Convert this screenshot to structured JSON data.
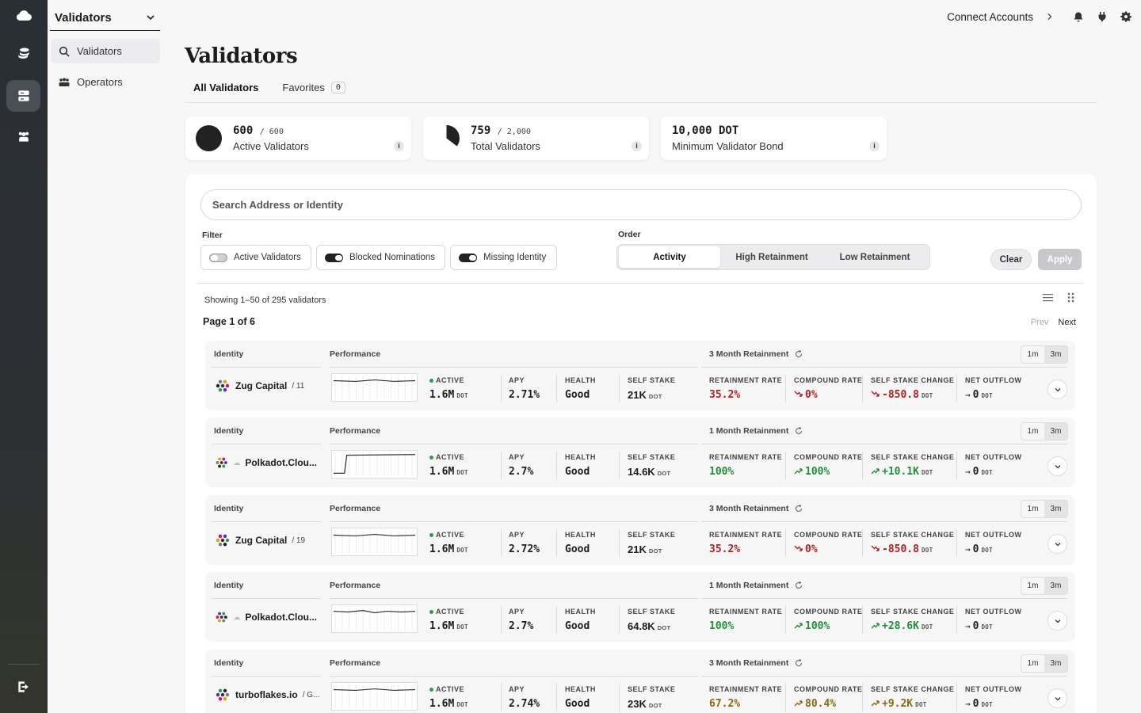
{
  "nav": {
    "selector_label": "Validators",
    "items": [
      {
        "label": "Validators"
      },
      {
        "label": "Operators"
      }
    ]
  },
  "header": {
    "connect_label": "Connect Accounts",
    "title": "Validators",
    "tabs": [
      {
        "label": "All Validators"
      },
      {
        "label": "Favorites",
        "count": "0"
      }
    ]
  },
  "stats": [
    {
      "value": "600",
      "total": "600",
      "label": "Active Validators"
    },
    {
      "value": "759",
      "total": "2,000",
      "label": "Total Validators"
    },
    {
      "value": "10,000 DOT",
      "label": "Minimum Validator Bond"
    }
  ],
  "search": {
    "placeholder": "Search Address or Identity"
  },
  "filter": {
    "label": "Filter",
    "chips": [
      {
        "label": "Active Validators",
        "on": false
      },
      {
        "label": "Blocked Nominations",
        "on": true
      },
      {
        "label": "Missing Identity",
        "on": true
      }
    ]
  },
  "order": {
    "label": "Order",
    "options": [
      "Activity",
      "High Retainment",
      "Low Retainment"
    ],
    "selected": "Activity"
  },
  "actions": {
    "clear": "Clear",
    "apply": "Apply"
  },
  "list": {
    "showing": "Showing 1–50 of 295 validators",
    "page": "Page 1 of 6",
    "prev": "Prev",
    "next": "Next"
  },
  "row_headers": {
    "identity": "Identity",
    "performance": "Performance",
    "tf1": "1m",
    "tf3": "3m"
  },
  "metric_keys": {
    "active": "ACTIVE",
    "apy": "APY",
    "health": "HEALTH",
    "self_stake": "SELF STAKE",
    "retainment": "RETAINMENT RATE",
    "compound": "COMPOUND RATE",
    "self_change": "SELF STAKE CHANGE",
    "outflow": "NET OUTFLOW",
    "unit": "DOT"
  },
  "rows": [
    {
      "name": "Zug Capital",
      "sub": "/ 11",
      "retention_label": "3 Month Retainment",
      "active": "1.6M",
      "apy": "2.71%",
      "health": "Good",
      "self_stake": "21K",
      "retainment": "35.2%",
      "compound": "0%",
      "self_change": "-850.8",
      "outflow": "0",
      "tone": "neg",
      "spark": "flat"
    },
    {
      "name": "Polkadot.Clou...",
      "sub": "",
      "retention_label": "1 Month Retainment",
      "active": "1.6M",
      "apy": "2.7%",
      "health": "Good",
      "self_stake": "14.6K",
      "retainment": "100%",
      "compound": "100%",
      "self_change": "+10.1K",
      "outflow": "0",
      "tone": "pos",
      "spark": "step"
    },
    {
      "name": "Zug Capital",
      "sub": "/ 19",
      "retention_label": "3 Month Retainment",
      "active": "1.6M",
      "apy": "2.72%",
      "health": "Good",
      "self_stake": "21K",
      "retainment": "35.2%",
      "compound": "0%",
      "self_change": "-850.8",
      "outflow": "0",
      "tone": "neg",
      "spark": "flat"
    },
    {
      "name": "Polkadot.Clou...",
      "sub": "",
      "retention_label": "1 Month Retainment",
      "active": "1.6M",
      "apy": "2.7%",
      "health": "Good",
      "self_stake": "64.8K",
      "retainment": "100%",
      "compound": "100%",
      "self_change": "+28.6K",
      "outflow": "0",
      "tone": "pos",
      "spark": "wave"
    },
    {
      "name": "turboflakes.io",
      "sub": "/ G...",
      "retention_label": "3 Month Retainment",
      "active": "1.6M",
      "apy": "2.74%",
      "health": "Good",
      "self_stake": "23K",
      "retainment": "67.2%",
      "compound": "80.4%",
      "self_change": "+9.2K",
      "outflow": "0",
      "tone": "mid",
      "spark": "flat"
    }
  ],
  "colors": {
    "positive": "#1f8f3a",
    "negative": "#b32020",
    "mid": "#8a6a10"
  }
}
